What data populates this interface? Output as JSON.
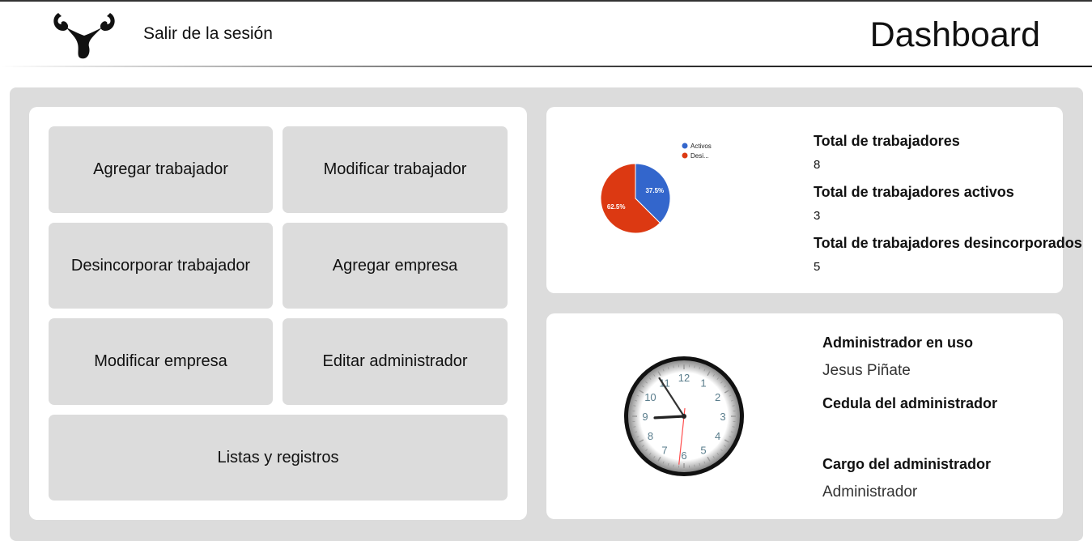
{
  "header": {
    "logout_label": "Salir de la sesión",
    "title": "Dashboard"
  },
  "actions": [
    {
      "label": "Agregar trabajador"
    },
    {
      "label": "Modificar trabajador"
    },
    {
      "label": "Desincorporar trabajador"
    },
    {
      "label": "Agregar empresa"
    },
    {
      "label": "Modificar empresa"
    },
    {
      "label": "Editar administrador"
    },
    {
      "label": "Listas y registros"
    }
  ],
  "stats": [
    {
      "label": "Total de trabajadores",
      "value": "8"
    },
    {
      "label": "Total de trabajadores activos",
      "value": "3"
    },
    {
      "label": "Total de trabajadores desincorporados",
      "value": "5"
    }
  ],
  "chart_data": {
    "type": "pie",
    "categories": [
      "Activos",
      "Desi..."
    ],
    "values": [
      3,
      5
    ],
    "data_labels": [
      "37.5%",
      "62.5%"
    ],
    "colors": [
      "#3366cc",
      "#dc3912"
    ],
    "legend": "top-right"
  },
  "clock": {
    "numerals": [
      "12",
      "1",
      "2",
      "3",
      "4",
      "5",
      "6",
      "7",
      "8",
      "9",
      "10",
      "11"
    ],
    "time": {
      "hour": 8,
      "minute": 54,
      "second": 31
    }
  },
  "admin": {
    "user_label": "Administrador en uso",
    "user_value": "Jesus Piñate",
    "id_label": "Cedula del administrador",
    "id_value": "",
    "role_label": "Cargo del administrador",
    "role_value": "Administrador"
  },
  "colors": {
    "panel_bg": "#dcdcdc",
    "card_bg": "#ffffff",
    "series_active": "#3366cc",
    "series_inactive": "#dc3912",
    "clock_second_hand": "#ff4d4d"
  },
  "icons": {
    "logo": "horned-logo-icon"
  }
}
